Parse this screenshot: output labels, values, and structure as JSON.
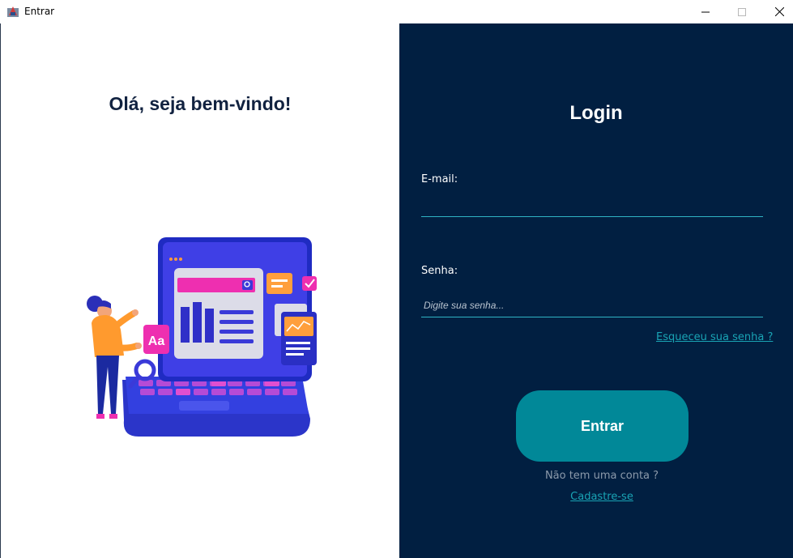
{
  "window": {
    "title": "Entrar",
    "minimize_icon": "minimize-icon",
    "maximize_icon": "maximize-icon",
    "close_icon": "close-icon"
  },
  "left": {
    "welcome": "Olá, seja bem-vindo!",
    "illustration_badge": "Aa"
  },
  "login": {
    "title": "Login",
    "email_label": "E-mail:",
    "email_value": "",
    "password_label": "Senha:",
    "password_placeholder": "Digite sua senha...",
    "forgot_password": "Esqueceu sua senha ?",
    "submit": "Entrar",
    "no_account": "Não tem uma conta ?",
    "signup": "Cadastre-se"
  },
  "colors": {
    "panel_bg": "#011f41",
    "accent": "#018898",
    "link": "#19a3b4",
    "heading": "#112240"
  }
}
